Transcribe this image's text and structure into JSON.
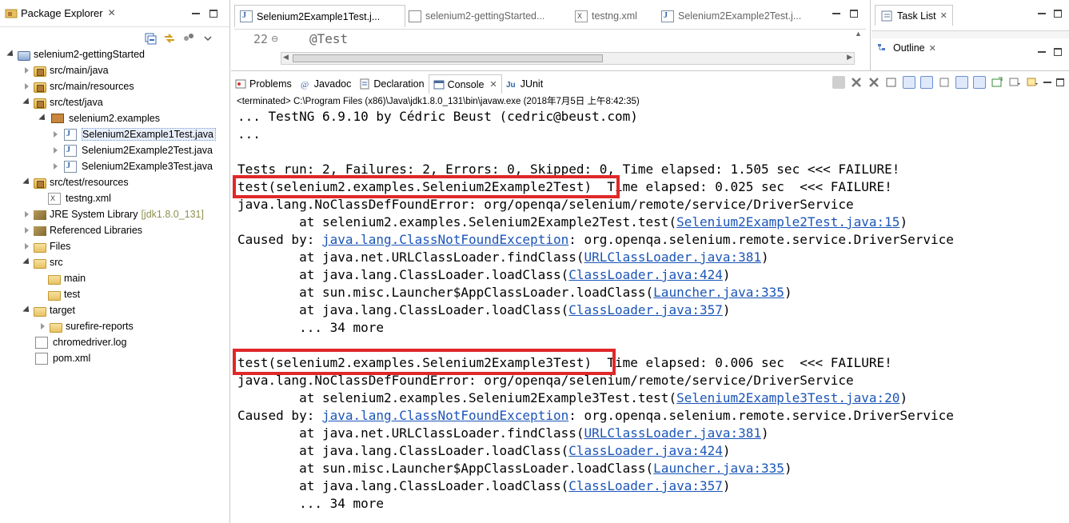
{
  "package_explorer": {
    "title": "Package Explorer",
    "items": [
      {
        "label": "selenium2-gettingStarted",
        "extra": ""
      },
      {
        "label": "src/main/java",
        "extra": ""
      },
      {
        "label": "src/main/resources",
        "extra": ""
      },
      {
        "label": "src/test/java",
        "extra": ""
      },
      {
        "label": "selenium2.examples",
        "extra": ""
      },
      {
        "label": "Selenium2Example1Test.java",
        "extra": ""
      },
      {
        "label": "Selenium2Example2Test.java",
        "extra": ""
      },
      {
        "label": "Selenium2Example3Test.java",
        "extra": ""
      },
      {
        "label": "src/test/resources",
        "extra": ""
      },
      {
        "label": "testng.xml",
        "extra": ""
      },
      {
        "label": "JRE System Library",
        "extra": "[jdk1.8.0_131]"
      },
      {
        "label": "Referenced Libraries",
        "extra": ""
      },
      {
        "label": "Files",
        "extra": ""
      },
      {
        "label": "src",
        "extra": ""
      },
      {
        "label": "main",
        "extra": ""
      },
      {
        "label": "test",
        "extra": ""
      },
      {
        "label": "target",
        "extra": ""
      },
      {
        "label": "surefire-reports",
        "extra": ""
      },
      {
        "label": "chromedriver.log",
        "extra": ""
      },
      {
        "label": "pom.xml",
        "extra": ""
      }
    ]
  },
  "editor": {
    "tabs": [
      {
        "label": "Selenium2Example1Test.j..."
      },
      {
        "label": "selenium2-gettingStarted..."
      },
      {
        "label": "testng.xml"
      },
      {
        "label": "Selenium2Example2Test.j..."
      }
    ],
    "line_number": "22",
    "code": "@Test"
  },
  "right_panel": {
    "task_list": "Task List",
    "outline": "Outline"
  },
  "console_panel": {
    "tabs": [
      "Problems",
      "Javadoc",
      "Declaration",
      "Console",
      "JUnit"
    ],
    "status": "<terminated> C:\\Program Files (x86)\\Java\\jdk1.8.0_131\\bin\\javaw.exe (2018年7月5日 上午8:42:35)",
    "lines": [
      {
        "text": "... TestNG 6.9.10 by Cédric Beust (cedric@beust.com)"
      },
      {
        "text": "..."
      },
      {
        "text": ""
      },
      {
        "text": "Tests run: 2, Failures: 2, Errors: 0, Skipped: 0, Time elapsed: 1.505 sec <<< FAILURE!"
      },
      {
        "text": "test(selenium2.examples.Selenium2Example2Test)  Time elapsed: 0.025 sec  <<< FAILURE!"
      },
      {
        "text": "java.lang.NoClassDefFoundError: org/openqa/selenium/remote/service/DriverService"
      },
      {
        "pre": "        at selenium2.examples.Selenium2Example2Test.test(",
        "link": "Selenium2Example2Test.java:15",
        "post": ")"
      },
      {
        "pre": "Caused by: ",
        "link": "java.lang.ClassNotFoundException",
        "post": ": org.openqa.selenium.remote.service.DriverService"
      },
      {
        "pre": "        at java.net.URLClassLoader.findClass(",
        "link": "URLClassLoader.java:381",
        "post": ")"
      },
      {
        "pre": "        at java.lang.ClassLoader.loadClass(",
        "link": "ClassLoader.java:424",
        "post": ")"
      },
      {
        "pre": "        at sun.misc.Launcher$AppClassLoader.loadClass(",
        "link": "Launcher.java:335",
        "post": ")"
      },
      {
        "pre": "        at java.lang.ClassLoader.loadClass(",
        "link": "ClassLoader.java:357",
        "post": ")"
      },
      {
        "text": "        ... 34 more"
      },
      {
        "text": ""
      },
      {
        "text": "test(selenium2.examples.Selenium2Example3Test)  Time elapsed: 0.006 sec  <<< FAILURE!"
      },
      {
        "text": "java.lang.NoClassDefFoundError: org/openqa/selenium/remote/service/DriverService"
      },
      {
        "pre": "        at selenium2.examples.Selenium2Example3Test.test(",
        "link": "Selenium2Example3Test.java:20",
        "post": ")"
      },
      {
        "pre": "Caused by: ",
        "link": "java.lang.ClassNotFoundException",
        "post": ": org.openqa.selenium.remote.service.DriverService"
      },
      {
        "pre": "        at java.net.URLClassLoader.findClass(",
        "link": "URLClassLoader.java:381",
        "post": ")"
      },
      {
        "pre": "        at java.lang.ClassLoader.loadClass(",
        "link": "ClassLoader.java:424",
        "post": ")"
      },
      {
        "pre": "        at sun.misc.Launcher$AppClassLoader.loadClass(",
        "link": "Launcher.java:335",
        "post": ")"
      },
      {
        "pre": "        at java.lang.ClassLoader.loadClass(",
        "link": "ClassLoader.java:357",
        "post": ")"
      },
      {
        "text": "        ... 34 more"
      }
    ]
  },
  "colors": {
    "link": "#1b55b8",
    "highlight_box": "#e0282a",
    "selection": "#e8eefa"
  }
}
